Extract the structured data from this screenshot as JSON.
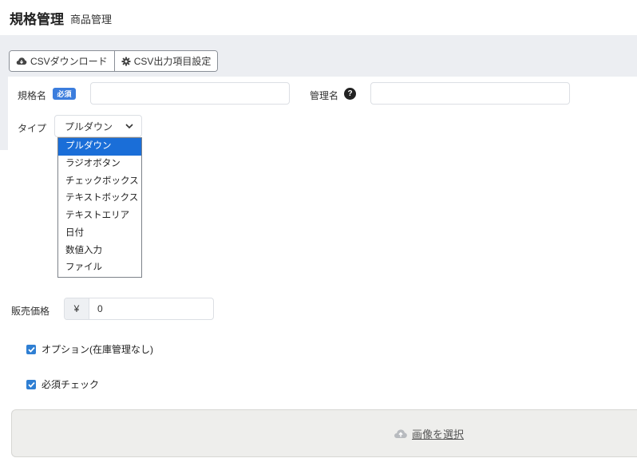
{
  "header": {
    "title": "規格管理",
    "subtitle": "商品管理"
  },
  "toolbar": {
    "csv_download": "CSVダウンロード",
    "csv_settings": "CSV出力項目設定"
  },
  "form": {
    "spec_name_label": "規格名",
    "required_badge": "必須",
    "spec_name_value": "",
    "admin_name_label": "管理名",
    "help_symbol": "?",
    "admin_name_value": "",
    "type_label": "タイプ",
    "type_selected": "プルダウン",
    "type_options": [
      "プルダウン",
      "ラジオボタン",
      "チェックボックス",
      "テキストボックス",
      "テキストエリア",
      "日付",
      "数値入力",
      "ファイル"
    ],
    "price_label": "販売価格",
    "currency_symbol": "¥",
    "price_value": "0",
    "option_checkbox_label": "オプション(在庫管理なし)",
    "required_checkbox_label": "必須チェック",
    "option_checked": true,
    "required_checked": true
  },
  "upload": {
    "label": "画像を選択",
    "icon": "cloud-upload-icon"
  },
  "colors": {
    "accent": "#1a6ed8",
    "badge": "#3b7ddd",
    "checkbox": "#2f7fd3",
    "band": "#eceef2"
  }
}
